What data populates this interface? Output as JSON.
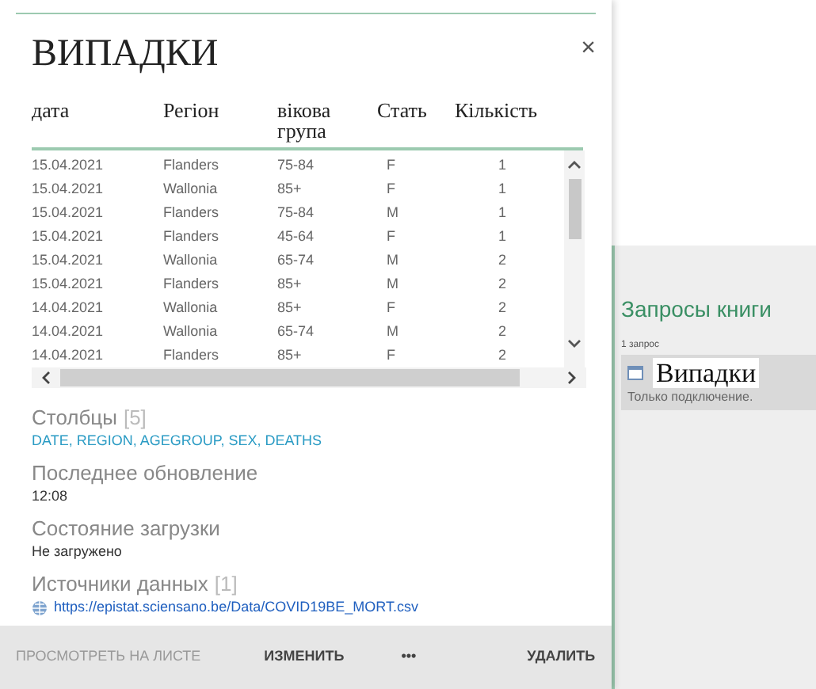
{
  "card": {
    "title": "ВИПАДКИ",
    "close": "×"
  },
  "table": {
    "columns": [
      "дата",
      "Регіон",
      "вікова група",
      "Стать",
      "Кількість"
    ],
    "rows": [
      [
        "15.04.2021",
        "Flanders",
        "75-84",
        "F",
        "1"
      ],
      [
        "15.04.2021",
        "Wallonia",
        "85+",
        "F",
        "1"
      ],
      [
        "15.04.2021",
        "Flanders",
        "75-84",
        "M",
        "1"
      ],
      [
        "15.04.2021",
        "Flanders",
        "45-64",
        "F",
        "1"
      ],
      [
        "15.04.2021",
        "Wallonia",
        "65-74",
        "M",
        "2"
      ],
      [
        "15.04.2021",
        "Flanders",
        "85+",
        "M",
        "2"
      ],
      [
        "14.04.2021",
        "Wallonia",
        "85+",
        "F",
        "2"
      ],
      [
        "14.04.2021",
        "Wallonia",
        "65-74",
        "M",
        "2"
      ],
      [
        "14.04.2021",
        "Flanders",
        "85+",
        "F",
        "2"
      ]
    ]
  },
  "details": [
    {
      "label": "Столбцы",
      "count": "[5]",
      "value": "DATE, REGION, AGEGROUP, SEX, DEATHS",
      "kind": "columns"
    },
    {
      "label": "Последнее обновление",
      "value": "12:08",
      "kind": "plain"
    },
    {
      "label": "Состояние загрузки",
      "value": "Не загружено",
      "kind": "plain"
    },
    {
      "label": "Источники данных",
      "count": "[1]",
      "value": "https://epistat.sciensano.be/Data/COVID19BE_MORT.csv",
      "kind": "link"
    }
  ],
  "actions": [
    {
      "label": "ПРОСМОТРЕТЬ НА ЛИСТЕ",
      "disabled": true
    },
    {
      "label": "ИЗМЕНИТЬ",
      "disabled": false
    },
    {
      "label": "•••",
      "disabled": false
    },
    {
      "label": "УДАЛИТЬ",
      "disabled": false
    }
  ],
  "queries_panel": {
    "title": "Запросы книги",
    "count": "1 запрос",
    "items": [
      {
        "name": "Випадки",
        "status": "Только подключение.",
        "selected": true
      }
    ]
  }
}
